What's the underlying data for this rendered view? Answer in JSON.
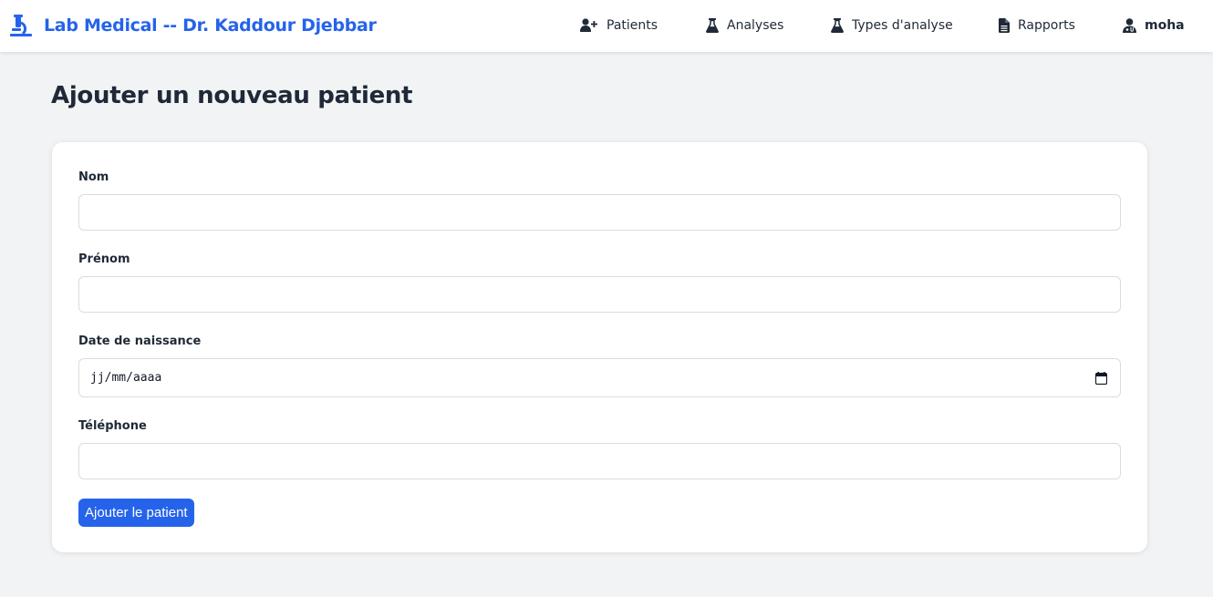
{
  "app": {
    "brand_title": "Lab Medical -- Dr. Kaddour Djebbar",
    "brand_icon": "microscope-icon",
    "accent_color": "#2563eb"
  },
  "nav": {
    "items": [
      {
        "label": "Patients",
        "icon": "user-plus-icon"
      },
      {
        "label": "Analyses",
        "icon": "flask-icon"
      },
      {
        "label": "Types d'analyse",
        "icon": "flask-icon"
      },
      {
        "label": "Rapports",
        "icon": "file-icon"
      },
      {
        "label": "moha",
        "icon": "user-doctor-icon"
      }
    ]
  },
  "page": {
    "title": "Ajouter un nouveau patient"
  },
  "form": {
    "nom": {
      "label": "Nom",
      "value": "",
      "placeholder": ""
    },
    "prenom": {
      "label": "Prénom",
      "value": "",
      "placeholder": ""
    },
    "date_naissance": {
      "label": "Date de naissance",
      "placeholder": "jj/mm/aaaa",
      "icon": "calendar-icon"
    },
    "telephone": {
      "label": "Téléphone",
      "value": "",
      "placeholder": ""
    },
    "submit_label": "Ajouter le patient"
  }
}
